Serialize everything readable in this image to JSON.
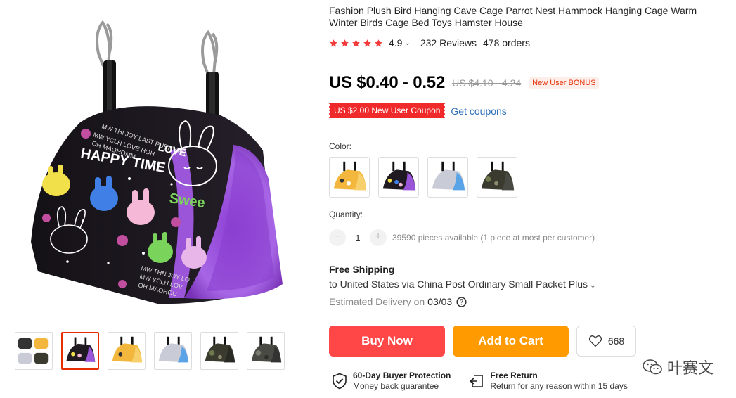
{
  "product": {
    "title": "Fashion Plush Bird Hanging Cave Cage Parrot Nest Hammock Hanging Cage Warm Winter Birds Cage Bed Toys Hamster House",
    "rating": "4.9",
    "rating_chevron": "⌄",
    "reviews": "232 Reviews",
    "orders": "478 orders",
    "star_count": 5,
    "price": "US $0.40 - 0.52",
    "original_price": "US $4.10 - 4.24",
    "bonus_label": "New User BONUS",
    "coupon_label": "US $2.00 New User Coupon",
    "get_coupons_label": "Get coupons"
  },
  "gallery": {
    "main_image_text": {
      "happy_time": "HAPPY TIME",
      "love": "LOVE",
      "sweet": "Swee",
      "small_1": "MW THI JOY LAST PURNVMR",
      "small_2": "MW YCLH LOVE HOH",
      "small_3": "OH MAOHOMM",
      "small_4": "MW THN JOY LO",
      "small_5": "MW YCLH LOV",
      "small_6": "OH MAOHOU"
    },
    "thumbnails": [
      {
        "name": "thumb-multi"
      },
      {
        "name": "thumb-black-bunny",
        "active": true
      },
      {
        "name": "thumb-yellow"
      },
      {
        "name": "thumb-blue"
      },
      {
        "name": "thumb-camo-green"
      },
      {
        "name": "thumb-camo-gray"
      }
    ]
  },
  "options": {
    "color_label": "Color:",
    "swatches": [
      {
        "name": "swatch-yellow",
        "fabric": "#f2b73c",
        "lining": "#f7d06b"
      },
      {
        "name": "swatch-black-bunny",
        "fabric": "#1f1a22",
        "lining": "#9b55d9"
      },
      {
        "name": "swatch-blue",
        "fabric": "#c9ccd6",
        "lining": "#5aa3e6"
      },
      {
        "name": "swatch-camo",
        "fabric": "#3b3a2e",
        "lining": "#4a4a44"
      }
    ],
    "quantity_label": "Quantity:",
    "quantity_minus": "−",
    "quantity_value": "1",
    "quantity_plus": "+",
    "availability": "39590 pieces available (1 piece at most per customer)"
  },
  "shipping": {
    "title": "Free Shipping",
    "route": "to United States via China Post Ordinary Small Packet Plus",
    "route_chevron": "⌄",
    "delivery_prefix": "Estimated Delivery on",
    "delivery_date": "03/03"
  },
  "actions": {
    "buy_now": "Buy Now",
    "add_to_cart": "Add to Cart",
    "wishlist_count": "668"
  },
  "guarantees": [
    {
      "title": "60-Day Buyer Protection",
      "subtitle": "Money back guarantee"
    },
    {
      "title": "Free Return",
      "subtitle": "Return for any reason within 15 days"
    }
  ],
  "watermark": {
    "text": "叶赛文"
  },
  "colors": {
    "accent_red": "#ff4747",
    "accent_orange": "#ff9a00",
    "coupon_red": "#f02a2a",
    "link_blue": "#2e6fb8",
    "star_red": "#f23b3b",
    "plush_purple": "#9b55d9"
  }
}
